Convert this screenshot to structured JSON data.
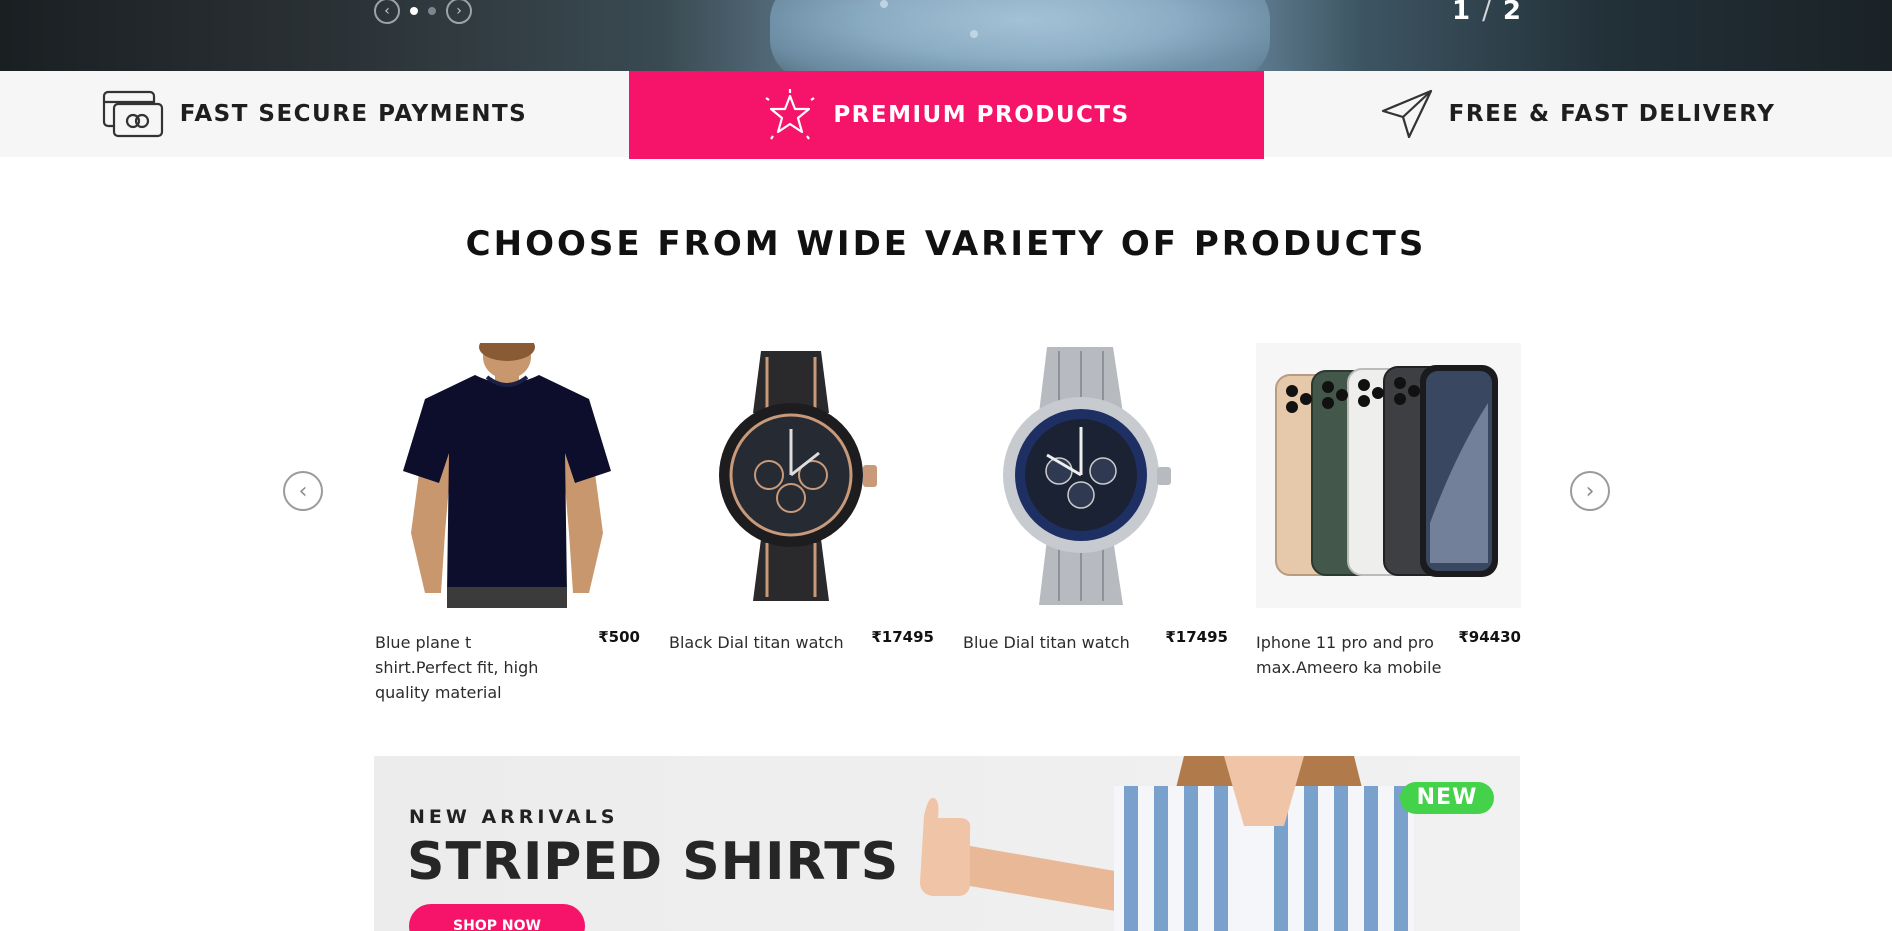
{
  "hero": {
    "current": "1",
    "separator": "/",
    "total": "2",
    "prev_icon": "chevron-left-icon",
    "next_icon": "chevron-right-icon"
  },
  "features": [
    {
      "label": "FAST SECURE PAYMENTS",
      "icon": "credit-card-icon"
    },
    {
      "label": "PREMIUM PRODUCTS",
      "icon": "star-icon",
      "active": true
    },
    {
      "label": "FREE & FAST DELIVERY",
      "icon": "paper-plane-icon"
    }
  ],
  "section": {
    "title": "CHOOSE FROM WIDE VARIETY OF PRODUCTS"
  },
  "products": [
    {
      "name": "Blue plane t shirt.Perfect fit, high quality material",
      "price": "₹500"
    },
    {
      "name": "Black Dial titan watch",
      "price": "₹17495"
    },
    {
      "name": "Blue Dial titan watch",
      "price": "₹17495"
    },
    {
      "name": "Iphone 11 pro and pro max.Ameero ka mobile",
      "price": "₹94430"
    }
  ],
  "banner": {
    "kicker": "NEW ARRIVALS",
    "headline": "STRIPED SHIRTS",
    "cta": "SHOP NOW",
    "badge": "NEW"
  },
  "colors": {
    "accent": "#f6136a",
    "badge": "#44d24a"
  }
}
